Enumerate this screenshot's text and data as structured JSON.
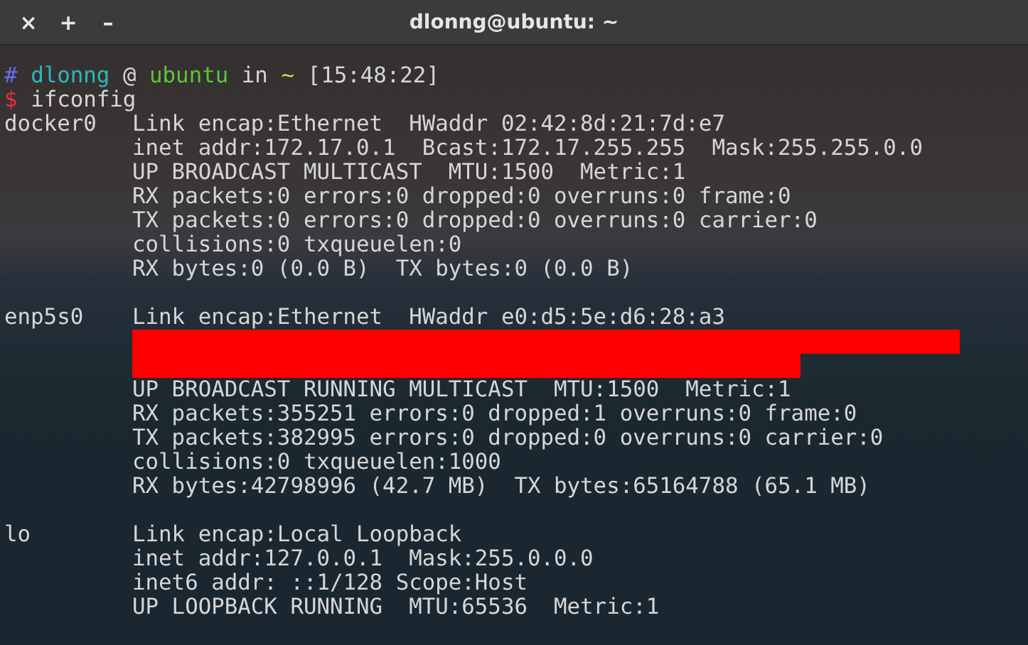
{
  "window": {
    "title": "dlonng@ubuntu: ~",
    "buttons": [
      "×",
      "+",
      "–"
    ]
  },
  "prompt": {
    "hash": "#",
    "user": "dlonng",
    "at": "@",
    "host": "ubuntu",
    "in": "in",
    "dir": "~",
    "time": "[15:48:22]"
  },
  "command": {
    "sign": "$",
    "text": "ifconfig"
  },
  "interfaces": [
    {
      "name": "docker0",
      "lines": [
        {
          "kind": "text",
          "text": "Link encap:Ethernet  HWaddr 02:42:8d:21:7d:e7"
        },
        {
          "kind": "text",
          "text": "inet addr:172.17.0.1  Bcast:172.17.255.255  Mask:255.255.0.0"
        },
        {
          "kind": "text",
          "text": "UP BROADCAST MULTICAST  MTU:1500  Metric:1"
        },
        {
          "kind": "text",
          "text": "RX packets:0 errors:0 dropped:0 overruns:0 frame:0"
        },
        {
          "kind": "text",
          "text": "TX packets:0 errors:0 dropped:0 overruns:0 carrier:0"
        },
        {
          "kind": "text",
          "text": "collisions:0 txqueuelen:0"
        },
        {
          "kind": "text",
          "text": "RX bytes:0 (0.0 B)  TX bytes:0 (0.0 B)"
        }
      ]
    },
    {
      "name": "enp5s0",
      "lines": [
        {
          "kind": "text",
          "text": "Link encap:Ethernet  HWaddr e0:d5:5e:d6:28:a3"
        },
        {
          "kind": "redacted"
        },
        {
          "kind": "text",
          "text": "UP BROADCAST RUNNING MULTICAST  MTU:1500  Metric:1"
        },
        {
          "kind": "text",
          "text": "RX packets:355251 errors:0 dropped:1 overruns:0 frame:0"
        },
        {
          "kind": "text",
          "text": "TX packets:382995 errors:0 dropped:0 overruns:0 carrier:0"
        },
        {
          "kind": "text",
          "text": "collisions:0 txqueuelen:1000"
        },
        {
          "kind": "text",
          "text": "RX bytes:42798996 (42.7 MB)  TX bytes:65164788 (65.1 MB)"
        }
      ]
    },
    {
      "name": "lo",
      "lines": [
        {
          "kind": "text",
          "text": "Link encap:Local Loopback"
        },
        {
          "kind": "text",
          "text": "inet addr:127.0.0.1  Mask:255.0.0.0"
        },
        {
          "kind": "text",
          "text": "inet6 addr: ::1/128 Scope:Host"
        },
        {
          "kind": "text",
          "text": "UP LOOPBACK RUNNING  MTU:65536  Metric:1"
        }
      ]
    }
  ]
}
